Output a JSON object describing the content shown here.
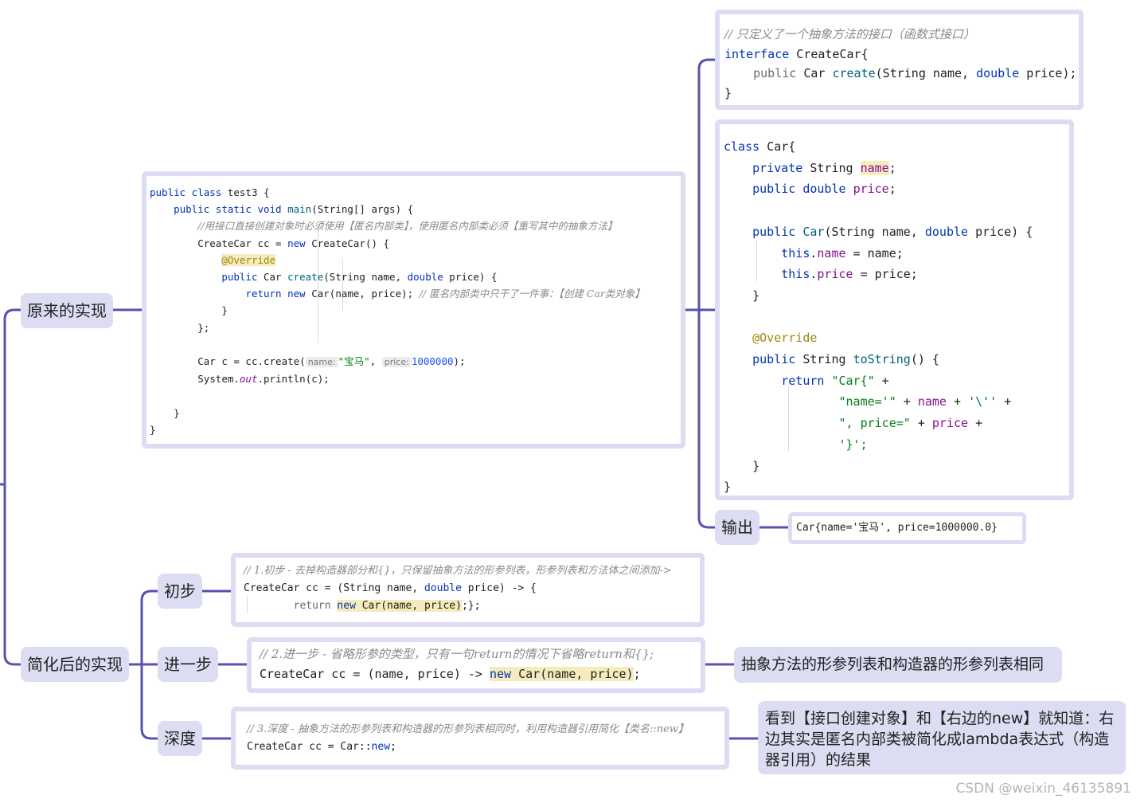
{
  "nodes": {
    "original": "原来的实现",
    "simplified": "简化后的实现",
    "output": "输出",
    "step1": "初步",
    "step2": "进一步",
    "step3": "深度"
  },
  "main_code": {
    "l1a": "public class",
    "l1b": " test3 {",
    "l2a": "public static void",
    "l2b": "main",
    "l2c": "(String[] args) {",
    "l3": "//用接口直接创建对象时必须使用【匿名内部类】，使用匿名内部类必须【重写其中的抽象方法】",
    "l4a": "CreateCar cc = ",
    "l4b": "new",
    "l4c": " CreateCar() {",
    "l5": "@Override",
    "l6a": "public",
    "l6b": " Car ",
    "l6c": "create",
    "l6d": "(String name, ",
    "l6e": "double",
    "l6f": " price) {",
    "l7a": "return",
    "l7b": "new",
    "l7c": " Car(name, price); ",
    "l7d": "// 匿名内部类中只干了一件事：【创建 Car类对象】",
    "l8": "}",
    "l9": "};",
    "l10a": "Car c = cc.create(",
    "l10_hint1": "name:",
    "l10b": "\"宝马\"",
    "l10c": ", ",
    "l10_hint2": "price:",
    "l10d": "1000000",
    "l10e": ");",
    "l11a": "System.",
    "l11b": "out",
    "l11c": ".println(c);",
    "l12": "}",
    "l13": "}"
  },
  "interface_code": {
    "comment": "// 只定义了一个抽象方法的接口（函数式接口）",
    "l1a": "interface",
    "l1b": " CreateCar{",
    "l2a": "public",
    "l2b": " Car ",
    "l2c": "create",
    "l2d": "(String name, ",
    "l2e": "double",
    "l2f": " price);",
    "l3": "}"
  },
  "car_code": {
    "l1a": "class",
    "l1b": " Car{",
    "l2a": "private",
    "l2b": " String ",
    "l2c": "name",
    "l2d": ";",
    "l3a": "public double",
    "l3b": " ",
    "l3c": "price",
    "l3d": ";",
    "l4a": "public",
    "l4b": " ",
    "l4c": "Car",
    "l4d": "(String name, ",
    "l4e": "double",
    "l4f": " price) {",
    "l5a": "this",
    "l5b": ".",
    "l5c": "name",
    "l5d": " = name;",
    "l6a": "this",
    "l6b": ".",
    "l6c": "price",
    "l6d": " = price;",
    "l7": "}",
    "l8": "@Override",
    "l9a": "public",
    "l9b": " String ",
    "l9c": "toString",
    "l9d": "() {",
    "l10a": "return",
    "l10b": " ",
    "l10c": "\"Car{\"",
    "l10d": " +",
    "l11a": "\"name='\"",
    "l11b": " + ",
    "l11c": "name",
    "l11d": " + ",
    "l11e": "'\\''",
    "l11f": " +",
    "l12a": "\", price=\"",
    "l12b": " + ",
    "l12c": "price",
    "l12d": " +",
    "l13": "'}';",
    "l14": "}",
    "l15": "}"
  },
  "output_value": "Car{name='宝马', price=1000000.0}",
  "step1_code": {
    "comment": "// 1.初步 - 去掉构造器部分和{}，只保留抽象方法的形参列表，形参列表和方法体之间添加->",
    "l1a": "CreateCar cc = (String name, ",
    "l1b": "double",
    "l1c": " price) -> {",
    "l2a": "return ",
    "l2b": "new",
    "l2c": " Car(name, price)",
    "l2d": ";};"
  },
  "step2_code": {
    "comment": "// 2.进一步 - 省略形参的类型，只有一句return的情况下省略return和{};",
    "l1a": "CreateCar cc = (name, price) -> ",
    "l1b": "new",
    "l1c": " Car(name, price)",
    "l1d": ";"
  },
  "step3_code": {
    "comment": "// 3.深度 - 抽象方法的形参列表和构造器的形参列表相同时，利用构造器引用简化【类名::new】",
    "l1a": "CreateCar cc = Car::",
    "l1b": "new",
    "l1c": ";"
  },
  "note_step2": "抽象方法的形参列表和构造器的形参列表相同",
  "note_step3": "看到【接口创建对象】和【右边的new】就知道：右边其实是匿名内部类被简化成lambda表达式（构造器引用）的结果",
  "watermark": "CSDN @weixin_46135891",
  "colors": {
    "connector": "#5552b0",
    "node_fill": "#dcdcf2",
    "keyword": "#0033b3",
    "field": "#871094",
    "string": "#067d17",
    "annotation": "#9e880d"
  }
}
